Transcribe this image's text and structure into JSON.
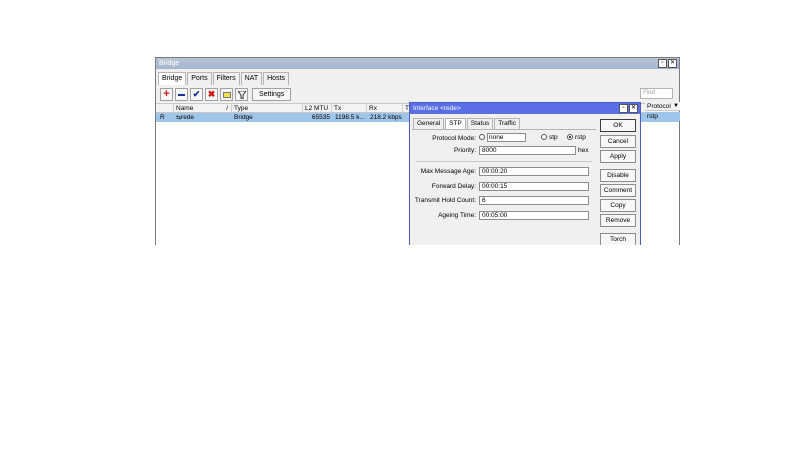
{
  "window": {
    "title": "Bridge",
    "tabs": [
      "Bridge",
      "Ports",
      "Filters",
      "NAT",
      "Hosts"
    ],
    "settings_label": "Settings",
    "find_placeholder": "Find"
  },
  "grid": {
    "columns": [
      "",
      "Name",
      "/",
      "Type",
      "L2 MTU",
      "Tx",
      "Rx",
      "T"
    ],
    "row": {
      "flag": "R",
      "name": "rede",
      "type": "Bridge",
      "l2mtu": "65535",
      "tx": "1198.5 k...",
      "rx": "218.2 kbps"
    },
    "protocol_header": "Protocol",
    "protocol_value": "rstp"
  },
  "dialog": {
    "title": "Interface <rede>",
    "tabs": [
      "General",
      "STP",
      "Status",
      "Traffic"
    ],
    "protocol_mode_label": "Protocol Mode:",
    "protocol_options": [
      "none",
      "stp",
      "rstp"
    ],
    "priority_label": "Priority:",
    "priority_value": "8000",
    "priority_unit": "hex",
    "max_age_label": "Max Message Age:",
    "max_age_value": "00:00:20",
    "fwd_delay_label": "Forward Delay:",
    "fwd_delay_value": "00:00:15",
    "hold_count_label": "Transmit Hold Count:",
    "hold_count_value": "6",
    "ageing_label": "Ageing Time:",
    "ageing_value": "00:05:00",
    "buttons": [
      "OK",
      "Cancel",
      "Apply",
      "Disable",
      "Comment",
      "Copy",
      "Remove",
      "Torch"
    ]
  },
  "colors": {
    "selection": "#9ec5ea",
    "dialog_title": "#5a6ee6",
    "window_title": "#a4b5cc"
  },
  "icons": [
    "add-icon",
    "remove-icon",
    "enable-icon",
    "disable-icon",
    "comment-icon",
    "filter-icon",
    "sort-icon",
    "bridge-icon"
  ]
}
